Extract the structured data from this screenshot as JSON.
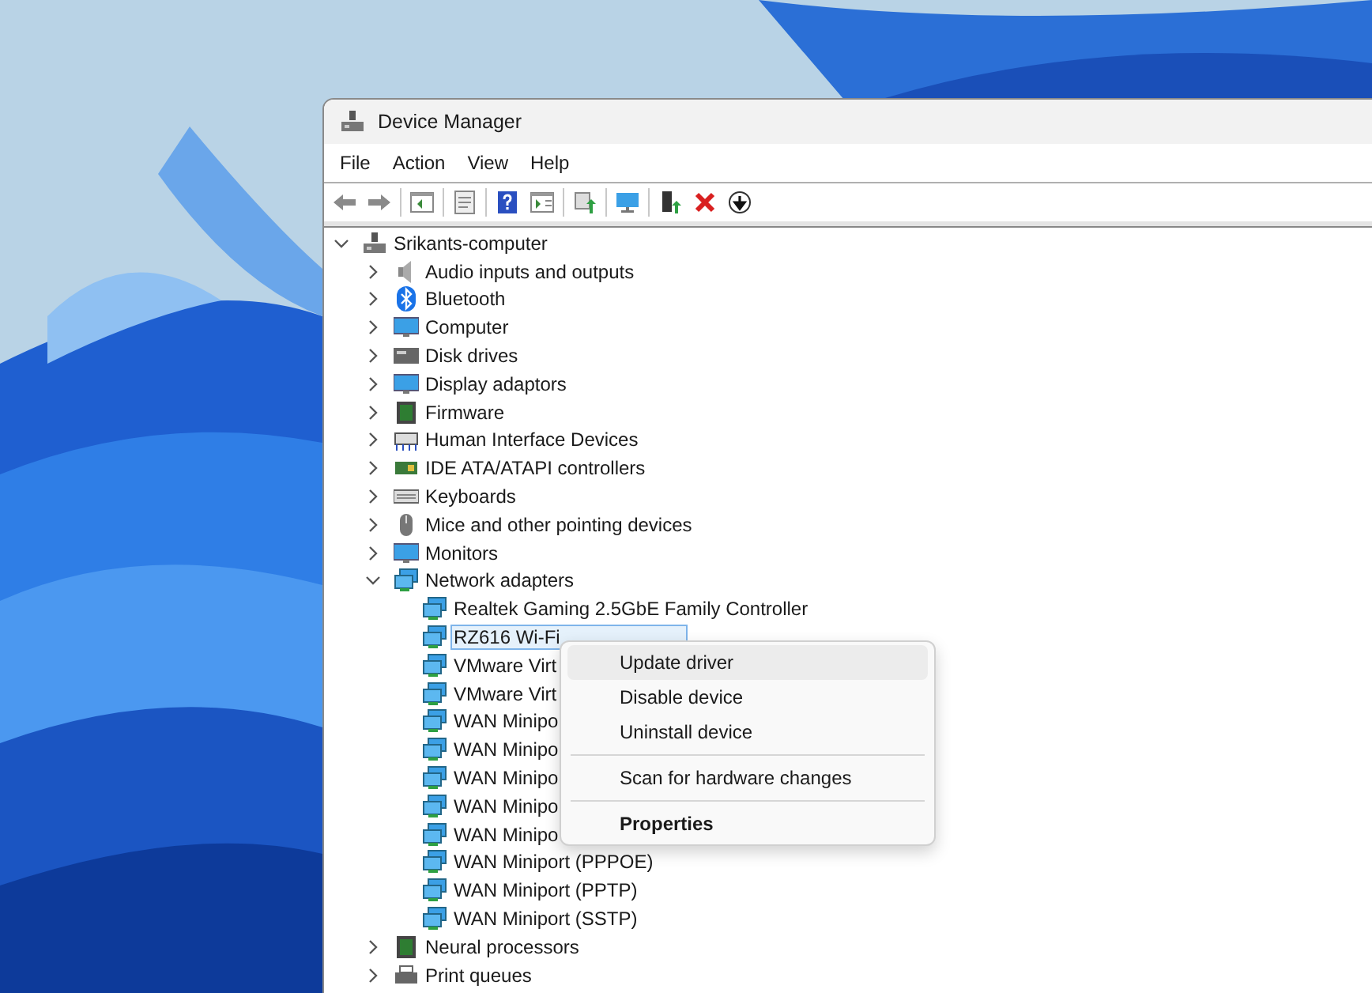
{
  "window": {
    "title": "Device Manager"
  },
  "menu_bar": [
    "File",
    "Action",
    "View",
    "Help"
  ],
  "tree": {
    "label": "Srikants-computer",
    "expanded": true,
    "children": [
      {
        "label": "Audio inputs and outputs",
        "expanded": false
      },
      {
        "label": "Bluetooth",
        "expanded": false
      },
      {
        "label": "Computer",
        "expanded": false
      },
      {
        "label": "Disk drives",
        "expanded": false
      },
      {
        "label": "Display adaptors",
        "expanded": false
      },
      {
        "label": "Firmware",
        "expanded": false
      },
      {
        "label": "Human Interface Devices",
        "expanded": false
      },
      {
        "label": "IDE ATA/ATAPI controllers",
        "expanded": false
      },
      {
        "label": "Keyboards",
        "expanded": false
      },
      {
        "label": "Mice and other pointing devices",
        "expanded": false
      },
      {
        "label": "Monitors",
        "expanded": false
      },
      {
        "label": "Network adapters",
        "expanded": true,
        "children": [
          {
            "label": "Realtek Gaming 2.5GbE Family Controller",
            "selected": false
          },
          {
            "label": "RZ616 Wi-Fi",
            "selected": true
          },
          {
            "label": "VMware Virt",
            "selected": false
          },
          {
            "label": "VMware Virt",
            "selected": false
          },
          {
            "label": "WAN Minipo",
            "selected": false
          },
          {
            "label": "WAN Minipo",
            "selected": false
          },
          {
            "label": "WAN Minipo",
            "selected": false
          },
          {
            "label": "WAN Minipo",
            "selected": false
          },
          {
            "label": "WAN Minipo",
            "selected": false
          },
          {
            "label": "WAN Miniport (PPPOE)",
            "selected": false
          },
          {
            "label": "WAN Miniport (PPTP)",
            "selected": false
          },
          {
            "label": "WAN Miniport (SSTP)",
            "selected": false
          }
        ]
      },
      {
        "label": "Neural processors",
        "expanded": false
      },
      {
        "label": "Print queues",
        "expanded": false
      }
    ]
  },
  "context_menu": [
    {
      "kind": "item",
      "label": "Update driver",
      "selected": true,
      "default": false
    },
    {
      "kind": "item",
      "label": "Disable device",
      "selected": false,
      "default": false
    },
    {
      "kind": "item",
      "label": "Uninstall device",
      "selected": false,
      "default": false
    },
    {
      "kind": "separator"
    },
    {
      "kind": "item",
      "label": "Scan for hardware changes",
      "selected": false,
      "default": false
    },
    {
      "kind": "separator"
    },
    {
      "kind": "item",
      "label": "Properties",
      "selected": false,
      "default": true
    }
  ]
}
